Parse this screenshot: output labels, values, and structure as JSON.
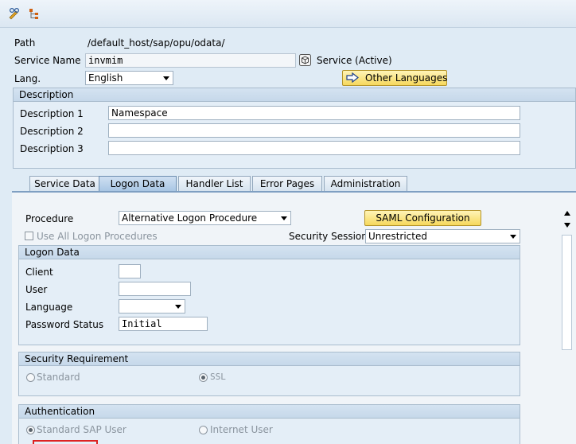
{
  "toolbar": {
    "icons": [
      "edit-glasses-icon",
      "hierarchy-icon"
    ]
  },
  "header": {
    "path_label": "Path",
    "path_value": "/default_host/sap/opu/odata/",
    "service_name_label": "Service Name",
    "service_name_value": "invmim",
    "service_status": "Service (Active)",
    "lang_label": "Lang.",
    "lang_value": "English",
    "other_languages_label": "Other Languages"
  },
  "description": {
    "title": "Description",
    "rows": [
      {
        "label": "Description 1",
        "value": "Namespace"
      },
      {
        "label": "Description 2",
        "value": ""
      },
      {
        "label": "Description 3",
        "value": ""
      }
    ]
  },
  "tabs": [
    "Service Data",
    "Logon Data",
    "Handler List",
    "Error Pages",
    "Administration"
  ],
  "active_tab": "Logon Data",
  "logon": {
    "procedure_label": "Procedure",
    "procedure_value": "Alternative Logon Procedure",
    "saml_button": "SAML Configuration",
    "use_all_label": "Use All Logon Procedures",
    "security_session_label": "Security Session:",
    "security_session_value": "Unrestricted",
    "logon_data_title": "Logon Data",
    "client_label": "Client",
    "client_value": "",
    "user_label": "User",
    "user_value": "",
    "language_label": "Language",
    "language_value": "",
    "password_status_label": "Password Status",
    "password_status_value": "Initial",
    "security_req_title": "Security Requirement",
    "standard_label": "Standard",
    "ssl_label": "SSL",
    "authentication_title": "Authentication",
    "std_sap_user_label": "Standard SAP User",
    "internet_user_label": "Internet User"
  },
  "colors": {
    "background": "#dfebf5",
    "button_yellow": "#f6d85c",
    "active_tab": "#a9c6e4"
  }
}
